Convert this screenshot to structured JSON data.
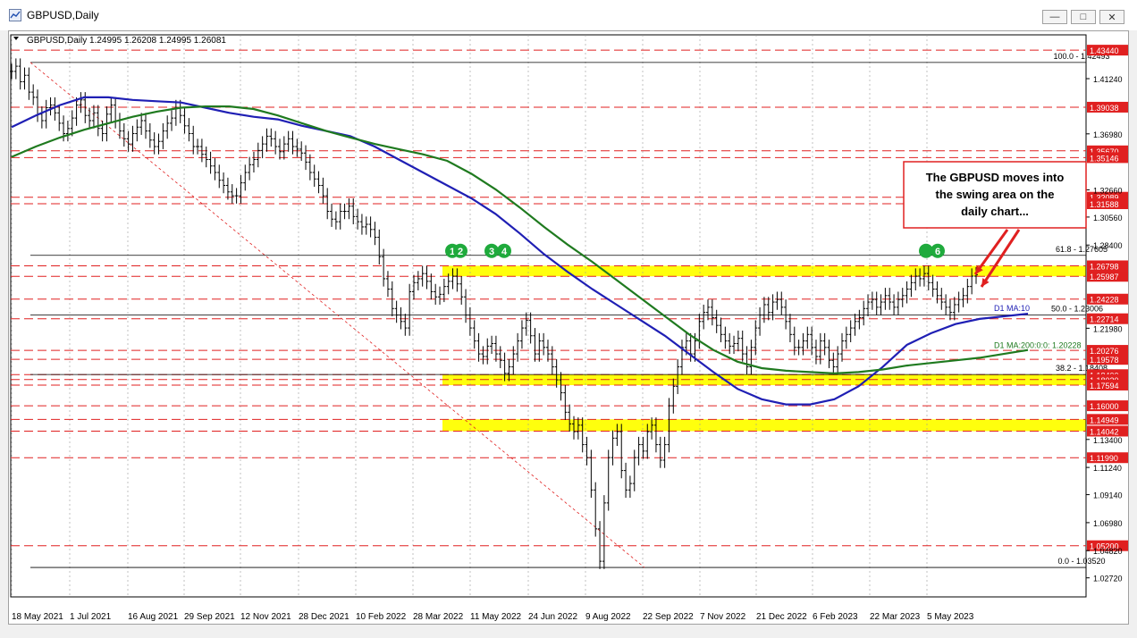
{
  "window": {
    "title": "GBPUSD,Daily",
    "min_label": "—",
    "max_label": "□",
    "close_label": "✕"
  },
  "header": {
    "symbol_info": "GBPUSD,Daily  1.24995 1.26208 1.24995 1.26081"
  },
  "annotation": {
    "line1": "The GBPUSD moves into",
    "line2": "the swing area on the",
    "line3": "daily chart..."
  },
  "colors": {
    "candle": "#000000",
    "ma100": "#1f1fb4",
    "ma200": "#1f7a1f",
    "hline": "#e02020",
    "zone": "#ffff00",
    "marker": "#1faa3c",
    "arrow": "#e02020",
    "grid": "#9a9a9a"
  },
  "chart_data": {
    "type": "line",
    "title": "GBPUSD,Daily",
    "series_info": "1.24995 1.26208 1.24995 1.26081",
    "xlabel": "",
    "ylabel": "",
    "ylim": [
      1.0125,
      1.4462
    ],
    "grid": true,
    "x_ticks": [
      "18 May 2021",
      "1 Jul 2021",
      "16 Aug 2021",
      "29 Sep 2021",
      "12 Nov 2021",
      "28 Dec 2021",
      "10 Feb 2022",
      "28 Mar 2022",
      "11 May 2022",
      "24 Jun 2022",
      "9 Aug 2022",
      "22 Sep 2022",
      "7 Nov 2022",
      "21 Dec 2022",
      "6 Feb 2023",
      "22 Mar 2023",
      "5 May 2023"
    ],
    "y_ticks": [
      1.4124,
      1.3698,
      1.3266,
      1.3056,
      1.284,
      1.2198,
      1.134,
      1.1124,
      1.0914,
      1.0698,
      1.0482,
      1.0272
    ],
    "levels": [
      {
        "label": "1.43440",
        "value": 1.4344
      },
      {
        "label": "1.39038",
        "value": 1.39038
      },
      {
        "label": "1.35670",
        "value": 1.3567
      },
      {
        "label": "1.35146",
        "value": 1.35146
      },
      {
        "label": "1.32089",
        "value": 1.32089
      },
      {
        "label": "1.31588",
        "value": 1.31588
      },
      {
        "label": "1.26798",
        "value": 1.26798
      },
      {
        "label": "1.25987",
        "value": 1.25987
      },
      {
        "label": "1.24228",
        "value": 1.24228
      },
      {
        "label": "1.22714",
        "value": 1.22714
      },
      {
        "label": "1.20276",
        "value": 1.20276
      },
      {
        "label": "1.19578",
        "value": 1.19578
      },
      {
        "label": "1.18400",
        "value": 1.184
      },
      {
        "label": "1.18020",
        "value": 1.1802
      },
      {
        "label": "1.17594",
        "value": 1.17594
      },
      {
        "label": "1.16000",
        "value": 1.16
      },
      {
        "label": "1.14949",
        "value": 1.14949
      },
      {
        "label": "1.14042",
        "value": 1.14042
      },
      {
        "label": "1.11990",
        "value": 1.1199
      },
      {
        "label": "1.05200",
        "value": 1.052
      }
    ],
    "zones": [
      [
        1.2599,
        1.268
      ],
      [
        1.1759,
        1.184
      ],
      [
        1.1404,
        1.1495
      ]
    ],
    "fib_levels": [
      {
        "label": "100.0 - 1.42493",
        "value": 1.42493
      },
      {
        "label": "61.8 - 1.27605",
        "value": 1.27605
      },
      {
        "label": "50.0 - 1.23006",
        "value": 1.23006
      },
      {
        "label": "38.2 - 1.18408",
        "value": 1.18408
      },
      {
        "label": "0.0 - 1.03520",
        "value": 1.0352
      }
    ],
    "ma_labels": [
      {
        "label": "D1 MA:10",
        "value": 1.231
      },
      {
        "label": "D1 MA:200:0:0: 1.20228",
        "value": 1.2023
      }
    ],
    "markers": [
      "1",
      "2",
      "3",
      "4",
      "",
      "6"
    ],
    "series": [
      {
        "name": "close",
        "values": [
          1.418,
          1.422,
          1.41,
          1.415,
          1.402,
          1.398,
          1.385,
          1.38,
          1.39,
          1.392,
          1.386,
          1.378,
          1.37,
          1.374,
          1.382,
          1.392,
          1.396,
          1.384,
          1.38,
          1.386,
          1.374,
          1.37,
          1.385,
          1.392,
          1.38,
          1.372,
          1.366,
          1.362,
          1.37,
          1.375,
          1.38,
          1.372,
          1.365,
          1.36,
          1.364,
          1.372,
          1.378,
          1.382,
          1.39,
          1.384,
          1.376,
          1.37,
          1.36,
          1.36,
          1.354,
          1.35,
          1.345,
          1.34,
          1.334,
          1.33,
          1.325,
          1.322,
          1.322,
          1.332,
          1.34,
          1.346,
          1.35,
          1.357,
          1.362,
          1.368,
          1.366,
          1.36,
          1.356,
          1.362,
          1.366,
          1.36,
          1.358,
          1.355,
          1.348,
          1.34,
          1.335,
          1.33,
          1.322,
          1.31,
          1.304,
          1.302,
          1.31,
          1.31,
          1.314,
          1.306,
          1.302,
          1.298,
          1.3,
          1.296,
          1.29,
          1.275,
          1.258,
          1.25,
          1.235,
          1.23,
          1.225,
          1.22,
          1.248,
          1.255,
          1.258,
          1.262,
          1.256,
          1.248,
          1.244,
          1.246,
          1.252,
          1.256,
          1.26,
          1.254,
          1.244,
          1.23,
          1.22,
          1.21,
          1.2,
          1.198,
          1.206,
          1.208,
          1.2,
          1.195,
          1.185,
          1.19,
          1.2,
          1.21,
          1.22,
          1.226,
          1.214,
          1.2,
          1.21,
          1.205,
          1.2,
          1.19,
          1.18,
          1.17,
          1.155,
          1.146,
          1.14,
          1.145,
          1.13,
          1.12,
          1.095,
          1.065,
          1.04,
          1.085,
          1.12,
          1.135,
          1.14,
          1.11,
          1.095,
          1.1,
          1.12,
          1.13,
          1.125,
          1.14,
          1.145,
          1.13,
          1.118,
          1.13,
          1.16,
          1.175,
          1.19,
          1.205,
          1.21,
          1.2,
          1.21,
          1.225,
          1.232,
          1.236,
          1.228,
          1.222,
          1.215,
          1.21,
          1.206,
          1.208,
          1.212,
          1.2,
          1.19,
          1.205,
          1.22,
          1.23,
          1.238,
          1.232,
          1.24,
          1.242,
          1.236,
          1.225,
          1.215,
          1.205,
          1.205,
          1.21,
          1.215,
          1.205,
          1.198,
          1.21,
          1.205,
          1.195,
          1.19,
          1.2,
          1.21,
          1.215,
          1.22,
          1.225,
          1.228,
          1.235,
          1.24,
          1.242,
          1.236,
          1.24,
          1.245,
          1.24,
          1.236,
          1.242,
          1.245,
          1.25,
          1.255,
          1.26,
          1.258,
          1.262,
          1.255,
          1.25,
          1.245,
          1.24,
          1.236,
          1.232,
          1.238,
          1.242,
          1.245,
          1.252,
          1.26,
          1.261
        ]
      },
      {
        "name": "",
        "values": [
          1.375,
          1.384,
          1.392,
          1.398,
          1.398,
          1.396,
          1.395,
          1.394,
          1.39,
          1.386,
          1.383,
          1.381,
          1.376,
          1.372,
          1.368,
          1.36,
          1.35,
          1.34,
          1.33,
          1.32,
          1.308,
          1.293,
          1.277,
          1.263,
          1.25,
          1.238,
          1.226,
          1.214,
          1.2,
          1.186,
          1.173,
          1.165,
          1.161,
          1.161,
          1.165,
          1.175,
          1.19,
          1.207,
          1.216,
          1.223,
          1.227,
          1.229,
          1.231
        ]
      },
      {
        "name": "",
        "values": [
          1.352,
          1.36,
          1.367,
          1.373,
          1.378,
          1.383,
          1.387,
          1.39,
          1.391,
          1.391,
          1.389,
          1.384,
          1.378,
          1.372,
          1.367,
          1.362,
          1.358,
          1.354,
          1.349,
          1.339,
          1.327,
          1.313,
          1.298,
          1.284,
          1.271,
          1.257,
          1.243,
          1.229,
          1.215,
          1.203,
          1.194,
          1.189,
          1.187,
          1.186,
          1.185,
          1.186,
          1.188,
          1.191,
          1.193,
          1.195,
          1.197,
          1.2,
          1.203
        ]
      }
    ]
  }
}
